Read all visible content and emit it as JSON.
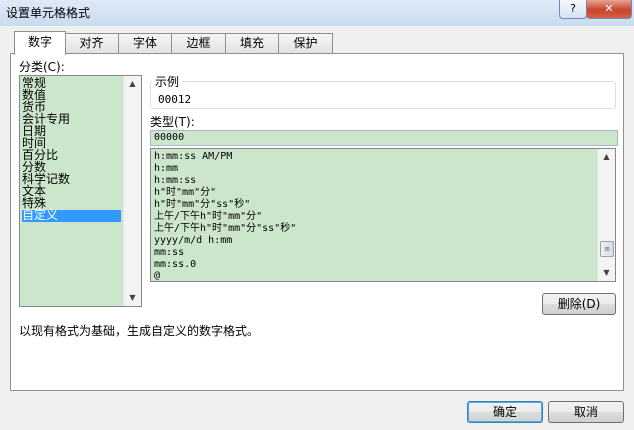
{
  "window": {
    "title": "设置单元格格式",
    "help_label": "?",
    "close_label": "✕"
  },
  "tabs": [
    {
      "label": "数字",
      "active": true
    },
    {
      "label": "对齐",
      "active": false
    },
    {
      "label": "字体",
      "active": false
    },
    {
      "label": "边框",
      "active": false
    },
    {
      "label": "填充",
      "active": false
    },
    {
      "label": "保护",
      "active": false
    }
  ],
  "category": {
    "label": "分类(C):",
    "items": [
      "常规",
      "数值",
      "货币",
      "会计专用",
      "日期",
      "时间",
      "百分比",
      "分数",
      "科学记数",
      "文本",
      "特殊",
      "自定义"
    ],
    "selected": "自定义"
  },
  "sample": {
    "label": "示例",
    "value": "00012"
  },
  "type": {
    "label": "类型(T):",
    "value": "00000",
    "formats": [
      "h:mm:ss AM/PM",
      "h:mm",
      "h:mm:ss",
      "h\"时\"mm\"分\"",
      "h\"时\"mm\"分\"ss\"秒\"",
      "上午/下午h\"时\"mm\"分\"",
      "上午/下午h\"时\"mm\"分\"ss\"秒\"",
      "yyyy/m/d h:mm",
      "mm:ss",
      "mm:ss.0",
      "@"
    ]
  },
  "delete_label": "删除(D)",
  "description": "以现有格式为基础，生成自定义的数字格式。",
  "ok_label": "确定",
  "cancel_label": "取消",
  "icons": {
    "scroll_up": "▲",
    "scroll_down": "▼",
    "thumb_grip": "≡"
  }
}
